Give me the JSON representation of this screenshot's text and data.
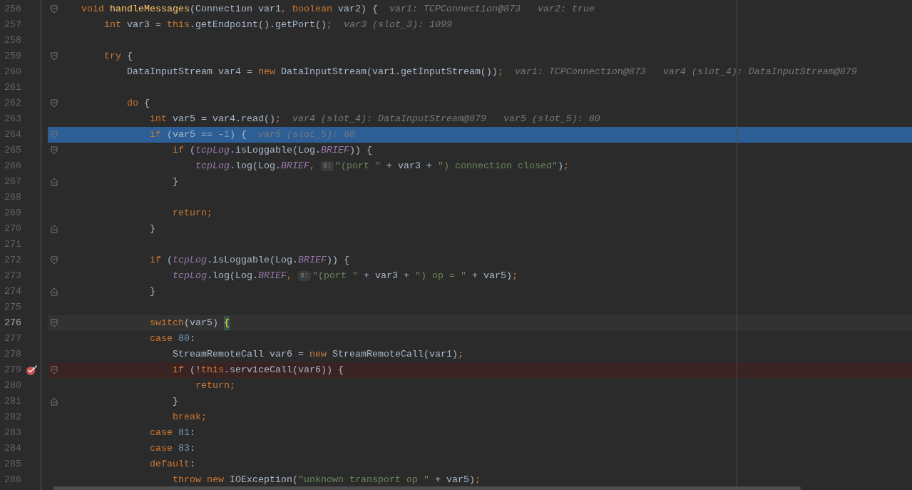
{
  "lines": [
    {
      "number": "256",
      "execution_point": false,
      "caret_line": false,
      "breakpoint": false,
      "fold_start": true,
      "fold_end": false,
      "tokens": [
        {
          "text": "    void ",
          "kind": "kw"
        },
        {
          "text": "handleMessages",
          "kind": "decl"
        },
        {
          "text": "(Connection var1",
          "kind": "plain"
        },
        {
          "text": ", boolean ",
          "kind": "kw"
        },
        {
          "text": "var2) {",
          "kind": "plain"
        },
        {
          "text": "var1: TCPConnection@873",
          "kind": "hint"
        },
        {
          "text": "var2: true",
          "kind": "hint"
        }
      ]
    },
    {
      "number": "257",
      "execution_point": false,
      "caret_line": false,
      "breakpoint": false,
      "fold_start": false,
      "fold_end": false,
      "tokens": [
        {
          "text": "        int ",
          "kind": "kw"
        },
        {
          "text": "var3 = ",
          "kind": "plain"
        },
        {
          "text": "this",
          "kind": "kw"
        },
        {
          "text": ".getEndpoint().getPort()",
          "kind": "plain"
        },
        {
          "text": ";",
          "kind": "kw"
        },
        {
          "text": "var3 (slot_3): 1099",
          "kind": "hint"
        }
      ]
    },
    {
      "number": "258",
      "execution_point": false,
      "caret_line": false,
      "breakpoint": false,
      "fold_start": false,
      "fold_end": false
    },
    {
      "number": "259",
      "execution_point": false,
      "caret_line": false,
      "breakpoint": false,
      "fold_start": true,
      "fold_end": false,
      "tokens": [
        {
          "text": "        try ",
          "kind": "kw"
        },
        {
          "text": "{",
          "kind": "plain"
        }
      ]
    },
    {
      "number": "260",
      "execution_point": false,
      "caret_line": false,
      "breakpoint": false,
      "fold_start": false,
      "fold_end": false,
      "tokens": [
        {
          "text": "            DataInputStream var4 = ",
          "kind": "plain"
        },
        {
          "text": "new ",
          "kind": "kw"
        },
        {
          "text": "DataInputStream(var1.getInputStream())",
          "kind": "plain"
        },
        {
          "text": ";",
          "kind": "kw"
        },
        {
          "text": "var1: TCPConnection@873",
          "kind": "hint"
        },
        {
          "text": "var4 (slot_4): DataInputStream@879",
          "kind": "hint"
        }
      ]
    },
    {
      "number": "261",
      "execution_point": false,
      "caret_line": false,
      "breakpoint": false,
      "fold_start": false,
      "fold_end": false
    },
    {
      "number": "262",
      "execution_point": false,
      "caret_line": false,
      "breakpoint": false,
      "fold_start": true,
      "fold_end": false,
      "tokens": [
        {
          "text": "            do ",
          "kind": "kw"
        },
        {
          "text": "{",
          "kind": "plain"
        }
      ]
    },
    {
      "number": "263",
      "execution_point": false,
      "caret_line": false,
      "breakpoint": false,
      "fold_start": false,
      "fold_end": false,
      "tokens": [
        {
          "text": "                int ",
          "kind": "kw"
        },
        {
          "text": "var5 = var4.read()",
          "kind": "plain"
        },
        {
          "text": ";",
          "kind": "kw"
        },
        {
          "text": "var4 (slot_4): DataInputStream@879",
          "kind": "hint"
        },
        {
          "text": "var5 (slot_5): 80",
          "kind": "hint"
        }
      ]
    },
    {
      "number": "264",
      "execution_point": true,
      "caret_line": false,
      "breakpoint": false,
      "fold_start": true,
      "fold_end": false,
      "tokens": [
        {
          "text": "                if ",
          "kind": "kw"
        },
        {
          "text": "(var5 == -",
          "kind": "plain"
        },
        {
          "text": "1",
          "kind": "num"
        },
        {
          "text": ") {",
          "kind": "plain"
        },
        {
          "text": "var5 (slot_5): 80",
          "kind": "hint"
        }
      ]
    },
    {
      "number": "265",
      "execution_point": false,
      "caret_line": false,
      "breakpoint": false,
      "fold_start": true,
      "fold_end": false,
      "tokens": [
        {
          "text": "                    if ",
          "kind": "kw"
        },
        {
          "text": "(",
          "kind": "plain"
        },
        {
          "text": "tcpLog",
          "kind": "field"
        },
        {
          "text": ".isLoggable(Log.",
          "kind": "plain"
        },
        {
          "text": "BRIEF",
          "kind": "field"
        },
        {
          "text": ")) {",
          "kind": "plain"
        }
      ]
    },
    {
      "number": "266",
      "execution_point": false,
      "caret_line": false,
      "breakpoint": false,
      "fold_start": false,
      "fold_end": false,
      "tokens": [
        {
          "text": "                        tcpLog",
          "kind": "field"
        },
        {
          "text": ".log(Log.",
          "kind": "plain"
        },
        {
          "text": "BRIEF",
          "kind": "field"
        },
        {
          "text": ", ",
          "kind": "kw"
        },
        {
          "text": "s:",
          "kind": "param"
        },
        {
          "text": "\"(port \" ",
          "kind": "str"
        },
        {
          "text": "+ var3 + ",
          "kind": "plain"
        },
        {
          "text": "\") connection closed\"",
          "kind": "str"
        },
        {
          "text": ")",
          "kind": "plain"
        },
        {
          "text": ";",
          "kind": "kw"
        }
      ]
    },
    {
      "number": "267",
      "execution_point": false,
      "caret_line": false,
      "breakpoint": false,
      "fold_start": false,
      "fold_end": true,
      "tokens": [
        {
          "text": "                    }",
          "kind": "plain"
        }
      ]
    },
    {
      "number": "268",
      "execution_point": false,
      "caret_line": false,
      "breakpoint": false,
      "fold_start": false,
      "fold_end": false
    },
    {
      "number": "269",
      "execution_point": false,
      "caret_line": false,
      "breakpoint": false,
      "fold_start": false,
      "fold_end": false,
      "tokens": [
        {
          "text": "                    return;",
          "kind": "kw"
        }
      ]
    },
    {
      "number": "270",
      "execution_point": false,
      "caret_line": false,
      "breakpoint": false,
      "fold_start": false,
      "fold_end": true,
      "tokens": [
        {
          "text": "                }",
          "kind": "plain"
        }
      ]
    },
    {
      "number": "271",
      "execution_point": false,
      "caret_line": false,
      "breakpoint": false,
      "fold_start": false,
      "fold_end": false
    },
    {
      "number": "272",
      "execution_point": false,
      "caret_line": false,
      "breakpoint": false,
      "fold_start": true,
      "fold_end": false,
      "tokens": [
        {
          "text": "                if ",
          "kind": "kw"
        },
        {
          "text": "(",
          "kind": "plain"
        },
        {
          "text": "tcpLog",
          "kind": "field"
        },
        {
          "text": ".isLoggable(Log.",
          "kind": "plain"
        },
        {
          "text": "BRIEF",
          "kind": "field"
        },
        {
          "text": ")) {",
          "kind": "plain"
        }
      ]
    },
    {
      "number": "273",
      "execution_point": false,
      "caret_line": false,
      "breakpoint": false,
      "fold_start": false,
      "fold_end": false,
      "tokens": [
        {
          "text": "                    tcpLog",
          "kind": "field"
        },
        {
          "text": ".log(Log.",
          "kind": "plain"
        },
        {
          "text": "BRIEF",
          "kind": "field"
        },
        {
          "text": ", ",
          "kind": "kw"
        },
        {
          "text": "s:",
          "kind": "param"
        },
        {
          "text": "\"(port \" ",
          "kind": "str"
        },
        {
          "text": "+ var3 + ",
          "kind": "plain"
        },
        {
          "text": "\") op = \" ",
          "kind": "str"
        },
        {
          "text": "+ var5)",
          "kind": "plain"
        },
        {
          "text": ";",
          "kind": "kw"
        }
      ]
    },
    {
      "number": "274",
      "execution_point": false,
      "caret_line": false,
      "breakpoint": false,
      "fold_start": false,
      "fold_end": true,
      "tokens": [
        {
          "text": "                }",
          "kind": "plain"
        }
      ]
    },
    {
      "number": "275",
      "execution_point": false,
      "caret_line": false,
      "breakpoint": false,
      "fold_start": false,
      "fold_end": false
    },
    {
      "number": "276",
      "execution_point": false,
      "caret_line": true,
      "breakpoint": false,
      "fold_start": true,
      "fold_end": false,
      "tokens": [
        {
          "text": "                switch",
          "kind": "kw"
        },
        {
          "text": "(var5) ",
          "kind": "plain"
        },
        {
          "text": "{",
          "kind": "brace"
        }
      ]
    },
    {
      "number": "277",
      "execution_point": false,
      "caret_line": false,
      "breakpoint": false,
      "fold_start": false,
      "fold_end": false,
      "tokens": [
        {
          "text": "                case ",
          "kind": "kw"
        },
        {
          "text": "80",
          "kind": "num"
        },
        {
          "text": ":",
          "kind": "plain"
        }
      ]
    },
    {
      "number": "278",
      "execution_point": false,
      "caret_line": false,
      "breakpoint": false,
      "fold_start": false,
      "fold_end": false,
      "tokens": [
        {
          "text": "                    StreamRemoteCall var6 = ",
          "kind": "plain"
        },
        {
          "text": "new ",
          "kind": "kw"
        },
        {
          "text": "StreamRemoteCall(var1)",
          "kind": "plain"
        },
        {
          "text": ";",
          "kind": "kw"
        }
      ]
    },
    {
      "number": "279",
      "execution_point": false,
      "caret_line": false,
      "breakpoint": true,
      "fold_start": true,
      "fold_end": false,
      "tokens": [
        {
          "text": "                    if ",
          "kind": "kw"
        },
        {
          "text": "(!",
          "kind": "plain"
        },
        {
          "text": "this",
          "kind": "kw"
        },
        {
          "text": ".serviceCall(var6)) {",
          "kind": "plain"
        }
      ]
    },
    {
      "number": "280",
      "execution_point": false,
      "caret_line": false,
      "breakpoint": false,
      "fold_start": false,
      "fold_end": false,
      "tokens": [
        {
          "text": "                        return;",
          "kind": "kw"
        }
      ]
    },
    {
      "number": "281",
      "execution_point": false,
      "caret_line": false,
      "breakpoint": false,
      "fold_start": false,
      "fold_end": true,
      "tokens": [
        {
          "text": "                    }",
          "kind": "plain"
        }
      ]
    },
    {
      "number": "282",
      "execution_point": false,
      "caret_line": false,
      "breakpoint": false,
      "fold_start": false,
      "fold_end": false,
      "tokens": [
        {
          "text": "                    break;",
          "kind": "kw"
        }
      ]
    },
    {
      "number": "283",
      "execution_point": false,
      "caret_line": false,
      "breakpoint": false,
      "fold_start": false,
      "fold_end": false,
      "tokens": [
        {
          "text": "                case ",
          "kind": "kw"
        },
        {
          "text": "81",
          "kind": "num"
        },
        {
          "text": ":",
          "kind": "plain"
        }
      ]
    },
    {
      "number": "284",
      "execution_point": false,
      "caret_line": false,
      "breakpoint": false,
      "fold_start": false,
      "fold_end": false,
      "tokens": [
        {
          "text": "                case ",
          "kind": "kw"
        },
        {
          "text": "83",
          "kind": "num"
        },
        {
          "text": ":",
          "kind": "plain"
        }
      ]
    },
    {
      "number": "285",
      "execution_point": false,
      "caret_line": false,
      "breakpoint": false,
      "fold_start": false,
      "fold_end": false,
      "tokens": [
        {
          "text": "                default",
          "kind": "kw"
        },
        {
          "text": ":",
          "kind": "plain"
        }
      ]
    },
    {
      "number": "286",
      "execution_point": false,
      "caret_line": false,
      "breakpoint": false,
      "fold_start": false,
      "fold_end": false,
      "tokens": [
        {
          "text": "                    throw new ",
          "kind": "kw"
        },
        {
          "text": "IOException(",
          "kind": "plain"
        },
        {
          "text": "\"unknown transport op \" ",
          "kind": "str"
        },
        {
          "text": "+ var5)",
          "kind": "plain"
        },
        {
          "text": ";",
          "kind": "kw"
        }
      ]
    }
  ]
}
